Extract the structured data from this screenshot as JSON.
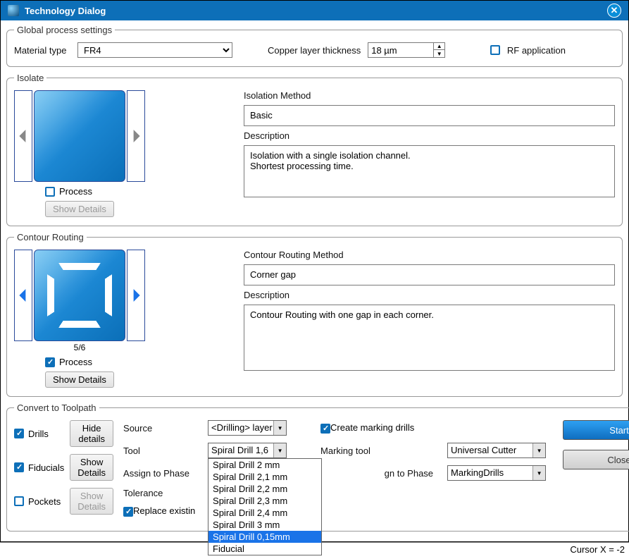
{
  "title": "Technology Dialog",
  "global": {
    "legend": "Global process settings",
    "material_label": "Material type",
    "material_value": "FR4",
    "copper_label": "Copper layer thickness",
    "copper_value": "18 µm",
    "rf_label": "RF application",
    "rf_checked": false
  },
  "isolate": {
    "legend": "Isolate",
    "method_label": "Isolation Method",
    "method_value": "Basic",
    "desc_label": "Description",
    "desc_value": "Isolation with a single isolation channel.\nShortest processing time.",
    "process_label": "Process",
    "process_checked": false,
    "details_btn": "Show Details"
  },
  "contour": {
    "legend": "Contour Routing",
    "counter": "5/6",
    "method_label": "Contour Routing Method",
    "method_value": "Corner gap",
    "desc_label": "Description",
    "desc_value": "Contour Routing with one gap in each corner.",
    "process_label": "Process",
    "process_checked": true,
    "details_btn": "Show Details"
  },
  "convert": {
    "legend": "Convert to Toolpath",
    "drills_label": "Drills",
    "drills_checked": true,
    "drills_btn": "Hide details",
    "fiducials_label": "Fiducials",
    "fiducials_checked": true,
    "fiducials_btn": "Show Details",
    "pockets_label": "Pockets",
    "pockets_checked": false,
    "pockets_btn": "Show Details",
    "source_label": "Source",
    "source_value": "<Drilling> layer",
    "tool_label": "Tool",
    "tool_value": "Spiral Drill   1,6",
    "tool_options": [
      "Spiral Drill   2 mm",
      "Spiral Drill   2,1 mm",
      "Spiral Drill   2,2 mm",
      "Spiral Drill   2,3 mm",
      "Spiral Drill   2,4 mm",
      "Spiral Drill   3 mm",
      "Spiral Drill 0,15mm",
      "Fiducial"
    ],
    "tool_selected_index": 6,
    "assign_label": "Assign to Phase",
    "tolerance_label": "Tolerance",
    "replace_label": "Replace existin",
    "replace_checked": true,
    "create_marking_label": "Create marking drills",
    "create_marking_checked": true,
    "marking_tool_label": "Marking tool",
    "marking_tool_value": "Universal Cutter",
    "marking_assign_label": "gn to Phase",
    "marking_assign_value": "MarkingDrills"
  },
  "actions": {
    "start": "Start",
    "close": "Close"
  },
  "status": "Cursor X =   -2"
}
